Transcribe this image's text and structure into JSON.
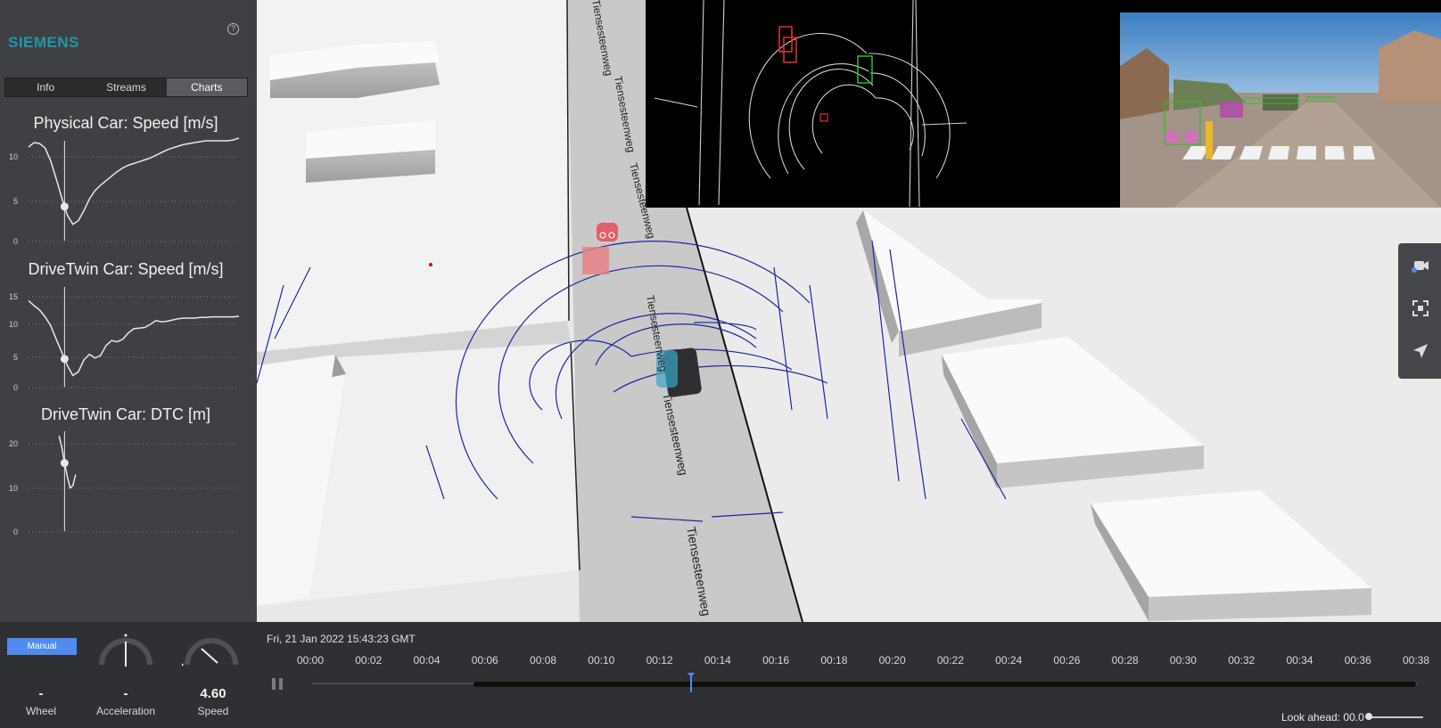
{
  "brand": {
    "logo": "SIEMENS",
    "accent": "#1e98a8"
  },
  "help_icon": "?",
  "tabs": [
    {
      "label": "Info",
      "active": false
    },
    {
      "label": "Streams",
      "active": false
    },
    {
      "label": "Charts",
      "active": true
    }
  ],
  "charts": {
    "physical_speed": {
      "title": "Physical Car: Speed [m/s]",
      "yticks": [
        "10",
        "5",
        "0"
      ]
    },
    "drivetwin_speed": {
      "title": "DriveTwin Car: Speed [m/s]",
      "yticks": [
        "15",
        "10",
        "5",
        "0"
      ]
    },
    "drivetwin_dtc": {
      "title": "DriveTwin Car: DTC [m]",
      "yticks": [
        "20",
        "10",
        "0"
      ]
    }
  },
  "chart_data": [
    {
      "type": "line",
      "title": "Physical Car: Speed [m/s]",
      "ylim": [
        0,
        11
      ],
      "x": [
        0,
        1,
        2,
        3,
        4,
        5,
        6,
        7,
        8,
        9,
        10,
        11,
        12,
        13,
        14,
        15,
        16,
        17,
        18,
        19,
        20,
        21,
        22,
        23,
        24,
        25,
        26,
        27,
        28,
        29,
        30,
        31,
        32,
        33,
        34,
        35,
        36,
        37,
        38
      ],
      "series": [
        {
          "values": [
            10.3,
            10.8,
            10.7,
            10.2,
            8.8,
            6.8,
            4.7,
            2.8,
            1.8,
            2.2,
            3.3,
            4.6,
            5.5,
            6.1,
            6.6,
            7.1,
            7.6,
            8.0,
            8.3,
            8.5,
            8.7,
            8.9,
            9.1,
            9.4,
            9.7,
            10.0,
            10.2,
            10.4,
            10.6,
            10.7,
            10.8,
            10.9,
            11.0,
            11.0,
            11.0,
            11.0,
            11.0,
            11.1,
            11.3
          ]
        }
      ],
      "cursor_x": 6.5
    },
    {
      "type": "line",
      "title": "DriveTwin Car: Speed [m/s]",
      "ylim": [
        0,
        16
      ],
      "x": [
        0,
        1,
        2,
        3,
        4,
        5,
        6,
        7,
        8,
        9,
        10,
        11,
        12,
        13,
        14,
        15,
        16,
        17,
        18,
        19,
        20,
        21,
        22,
        23,
        24,
        25,
        26,
        27,
        28,
        29,
        30,
        31,
        32,
        33,
        34,
        35,
        36,
        37,
        38
      ],
      "series": [
        {
          "values": [
            13.8,
            13.0,
            12.3,
            11.2,
            9.8,
            7.6,
            5.5,
            3.4,
            1.8,
            2.4,
            4.3,
            5.2,
            4.6,
            5.0,
            6.6,
            7.4,
            7.2,
            7.6,
            8.6,
            9.3,
            9.4,
            9.5,
            10.0,
            10.6,
            10.4,
            10.5,
            10.7,
            10.9,
            11.0,
            11.0,
            11.0,
            11.1,
            11.1,
            11.2,
            11.2,
            11.2,
            11.2,
            11.2,
            11.3
          ]
        }
      ],
      "cursor_x": 6.5
    },
    {
      "type": "line",
      "title": "DriveTwin Car: DTC [m]",
      "ylim": [
        0,
        22
      ],
      "x": [
        5.5,
        6.0,
        6.5,
        7.0,
        7.5,
        8.0,
        8.5
      ],
      "series": [
        {
          "values": [
            21.0,
            18.5,
            15.0,
            12.0,
            9.5,
            10.0,
            12.5
          ]
        }
      ],
      "cursor_x": 6.5
    }
  ],
  "controls": {
    "mode_button": "Manual",
    "gauges": [
      {
        "value": "-",
        "label": "Wheel"
      },
      {
        "value": "-",
        "label": "Acceleration"
      },
      {
        "value": "4.60",
        "label": "Speed"
      }
    ]
  },
  "map_labels": [
    "Tiensesteenweg",
    "Tiensesteenweg",
    "Tiensesteenweg",
    "Tiensesteenweg",
    "Tiensesteenweg",
    "Tiensesteenweg"
  ],
  "toolbar": [
    {
      "icon": "camera-icon"
    },
    {
      "icon": "fullscreen-icon"
    },
    {
      "icon": "navigation-arrow-icon"
    }
  ],
  "timeline": {
    "datetime": "Fri, 21 Jan 2022 15:43:23 GMT",
    "ticks": [
      "00:00",
      "00:02",
      "00:04",
      "00:06",
      "00:08",
      "00:10",
      "00:12",
      "00:14",
      "00:16",
      "00:18",
      "00:20",
      "00:22",
      "00:24",
      "00:26",
      "00:28",
      "00:30",
      "00:32",
      "00:34",
      "00:36",
      "00:38"
    ],
    "duration_s": 38,
    "loaded_start_s": 5.6,
    "playhead_s": 13.1,
    "look_ahead_label": "Look ahead: 00.0"
  }
}
